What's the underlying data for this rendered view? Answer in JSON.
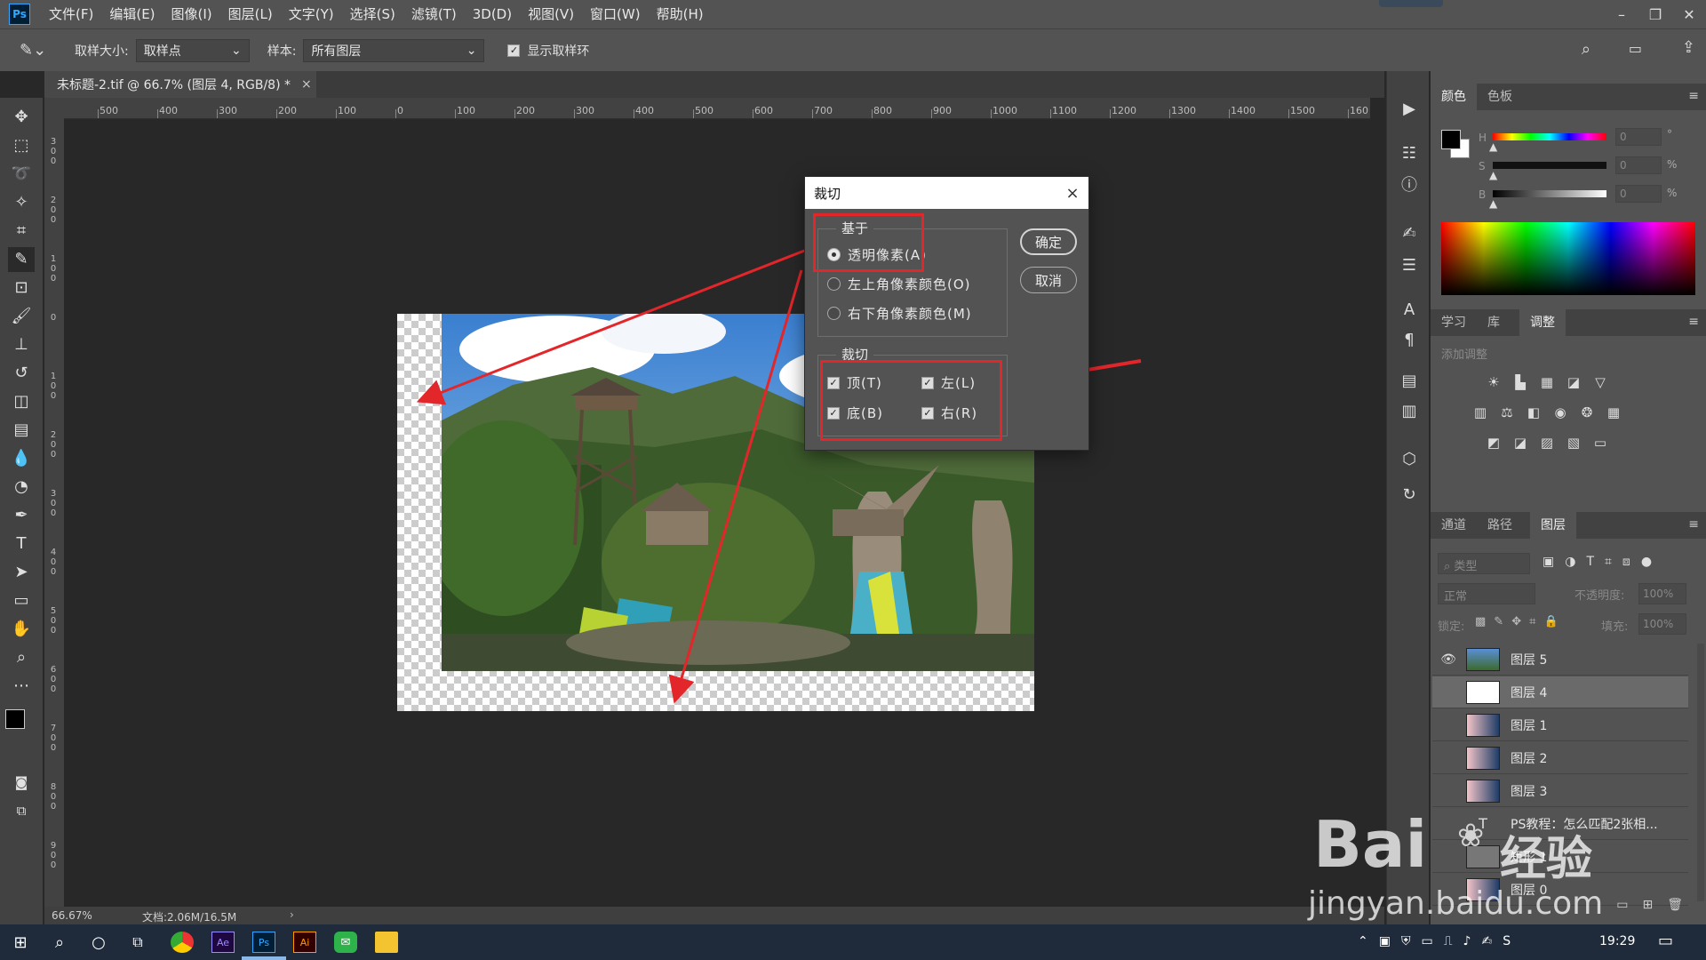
{
  "menubar": {
    "logo": "Ps",
    "items": [
      "文件(F)",
      "编辑(E)",
      "图像(I)",
      "图层(L)",
      "文字(Y)",
      "选择(S)",
      "滤镜(T)",
      "3D(D)",
      "视图(V)",
      "窗口(W)",
      "帮助(H)"
    ]
  },
  "options": {
    "sample_size_label": "取样大小:",
    "sample_size_value": "取样点",
    "sample_label": "样本:",
    "sample_value": "所有图层",
    "show_ring_label": "显示取样环"
  },
  "document": {
    "tab_title": "未标题-2.tif @ 66.7% (图层 4, RGB/8) *",
    "close": "×",
    "zoom": "66.67%",
    "doc_size": "文档:2.06M/16.5M",
    "ruler_h": [
      "500",
      "400",
      "300",
      "200",
      "100",
      "0",
      "100",
      "200",
      "300",
      "400",
      "500",
      "600",
      "700",
      "800",
      "900",
      "1000",
      "1100",
      "1200",
      "1300",
      "1400",
      "1500",
      "160"
    ],
    "ruler_v": [
      "3\n0\n0",
      "2\n0\n0",
      "1\n0\n0",
      "0",
      "1\n0\n0",
      "2\n0\n0",
      "3\n0\n0",
      "4\n0\n0",
      "5\n0\n0",
      "6\n0\n0",
      "7\n0\n0",
      "8\n0\n0",
      "9\n0\n0"
    ]
  },
  "dialog": {
    "title": "裁切",
    "close": "×",
    "based_on_label": "基于",
    "options": [
      "透明像素(A)",
      "左上角像素颜色(O)",
      "右下角像素颜色(M)"
    ],
    "selected_index": 0,
    "trim_label": "裁切",
    "trim_checks": [
      "顶(T)",
      "左(L)",
      "底(B)",
      "右(R)"
    ],
    "ok": "确定",
    "cancel": "取消"
  },
  "color_panel": {
    "tabs": [
      "颜色",
      "色板"
    ],
    "labels": [
      "H",
      "S",
      "B"
    ],
    "values": [
      "0",
      "0",
      "0"
    ],
    "units": [
      "°",
      "%",
      "%"
    ]
  },
  "adjust_panel": {
    "tabs": [
      "学习",
      "库",
      "调整"
    ],
    "hint": "添加调整"
  },
  "layers_panel": {
    "tabs": [
      "通道",
      "路径",
      "图层"
    ],
    "filter_placeholder": "类型",
    "blend_mode": "正常",
    "opacity_label": "不透明度:",
    "opacity_value": "100%",
    "lock_label": "锁定:",
    "fill_label": "填充:",
    "fill_value": "100%",
    "layers": [
      "图层 5",
      "图层 4",
      "图层 1",
      "图层 2",
      "图层 3",
      "PS教程：怎么匹配2张相...",
      "矩形 1",
      "图层 0"
    ]
  },
  "taskbar": {
    "time": "19:29"
  },
  "watermark": {
    "brand": "Bai",
    "brand_cn": "经验",
    "url": "jingyan.baidu.com"
  },
  "colors": {
    "accent_red": "#e3262a",
    "ui_dark": "#535353"
  }
}
